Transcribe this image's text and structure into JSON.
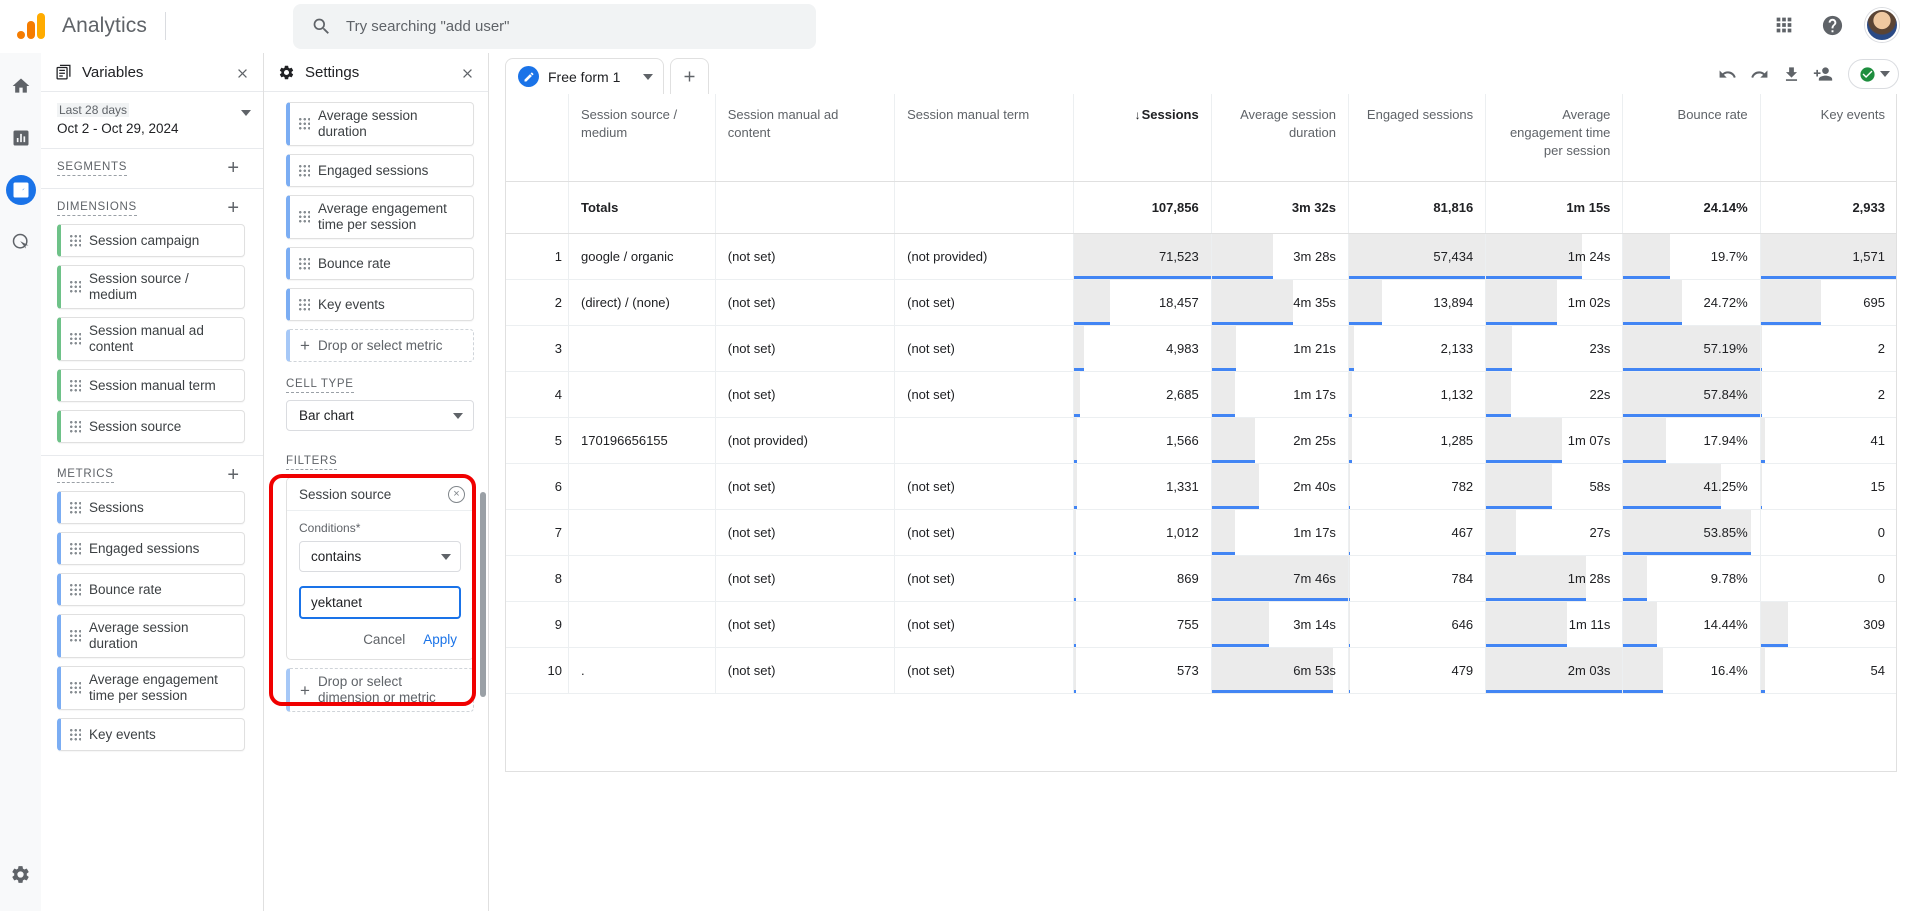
{
  "topbar": {
    "brand": "Analytics",
    "search_placeholder": "Try searching \"add user\"",
    "icons": {
      "search": "search-icon",
      "apps": "apps-grid-icon",
      "help": "help-circle-icon",
      "avatar": "user-avatar"
    }
  },
  "rail": {
    "items": [
      {
        "name": "home",
        "label": "Home"
      },
      {
        "name": "reports",
        "label": "Reports"
      },
      {
        "name": "explore",
        "label": "Explore",
        "active": true
      },
      {
        "name": "advertising",
        "label": "Advertising"
      },
      {
        "name": "admin",
        "label": "Admin"
      }
    ]
  },
  "variables": {
    "title": "Variables",
    "close_label": "×",
    "date_range": {
      "label": "Last 28 days",
      "value": "Oct 2 - Oct 29, 2024"
    },
    "segments": {
      "title": "SEGMENTS",
      "add": "+",
      "items": []
    },
    "dimensions": {
      "title": "DIMENSIONS",
      "add": "+",
      "items": [
        "Session campaign",
        "Session source / medium",
        "Session manual ad content",
        "Session manual term",
        "Session source"
      ]
    },
    "metrics": {
      "title": "METRICS",
      "add": "+",
      "items": [
        "Sessions",
        "Engaged sessions",
        "Bounce rate",
        "Average session duration",
        "Average engagement time per session",
        "Key events"
      ]
    }
  },
  "settings": {
    "title": "Settings",
    "close_label": "×",
    "values_metrics": [
      "Average session duration",
      "Engaged sessions",
      "Average engagement time per session",
      "Bounce rate",
      "Key events"
    ],
    "drop_metric": "Drop or select metric",
    "cell_type": {
      "title": "CELL TYPE",
      "value": "Bar chart"
    },
    "filters": {
      "title": "FILTERS",
      "dimension": "Session source",
      "clear_icon": "clear-circle-icon",
      "conditions_label": "Conditions*",
      "match_type": "contains",
      "value": "yektanet",
      "value_placeholder": "",
      "cancel_label": "Cancel",
      "apply_label": "Apply"
    },
    "drop_dimension_or_metric": "Drop or select dimension or metric"
  },
  "report": {
    "tab": {
      "label": "Free form 1",
      "icon": "pencil-icon"
    },
    "add_tab": "+",
    "tools": [
      {
        "name": "undo-icon",
        "label": "Undo"
      },
      {
        "name": "redo-icon",
        "label": "Redo"
      },
      {
        "name": "download-icon",
        "label": "Download"
      },
      {
        "name": "share-user-icon",
        "label": "Share"
      },
      {
        "name": "check-circle-icon",
        "label": "Saved"
      },
      {
        "name": "chevron-down-icon",
        "label": "More"
      }
    ]
  },
  "table": {
    "columns": [
      {
        "key": "idx",
        "label": "",
        "align": "right"
      },
      {
        "key": "source_medium",
        "label": "Session source / medium",
        "align": "left"
      },
      {
        "key": "ad_content",
        "label": "Session manual ad content",
        "align": "left"
      },
      {
        "key": "manual_term",
        "label": "Session manual term",
        "align": "left"
      },
      {
        "key": "sessions",
        "label": "Sessions",
        "align": "right",
        "sorted": true,
        "sort_arrow": "↓"
      },
      {
        "key": "avg_session_duration",
        "label": "Average session duration",
        "align": "right"
      },
      {
        "key": "engaged_sessions",
        "label": "Engaged sessions",
        "align": "right"
      },
      {
        "key": "avg_engagement_time",
        "label": "Average engagement time per session",
        "align": "right"
      },
      {
        "key": "bounce_rate",
        "label": "Bounce rate",
        "align": "right"
      },
      {
        "key": "key_events",
        "label": "Key events",
        "align": "right"
      }
    ],
    "totals": {
      "label": "Totals",
      "sessions": "107,856",
      "avg_session_duration": "3m 32s",
      "engaged_sessions": "81,816",
      "avg_engagement_time": "1m 15s",
      "bounce_rate": "24.14%",
      "key_events": "2,933"
    },
    "rows": [
      {
        "idx": "1",
        "source_medium": "google / organic",
        "ad_content": "(not set)",
        "manual_term": "(not provided)",
        "sessions": "71,523",
        "sessions_pct": 100,
        "avg_session_duration": "3m 28s",
        "avg_session_duration_pct": 45,
        "engaged_sessions": "57,434",
        "engaged_sessions_pct": 100,
        "avg_engagement_time": "1m 24s",
        "avg_engagement_time_pct": 70,
        "bounce_rate": "19.7%",
        "bounce_rate_pct": 34,
        "key_events": "1,571",
        "key_events_pct": 100
      },
      {
        "idx": "2",
        "source_medium": "(direct) / (none)",
        "ad_content": "(not set)",
        "manual_term": "(not set)",
        "sessions": "18,457",
        "sessions_pct": 26,
        "avg_session_duration": "4m 35s",
        "avg_session_duration_pct": 60,
        "engaged_sessions": "13,894",
        "engaged_sessions_pct": 24,
        "avg_engagement_time": "1m 02s",
        "avg_engagement_time_pct": 52,
        "bounce_rate": "24.72%",
        "bounce_rate_pct": 43,
        "key_events": "695",
        "key_events_pct": 44
      },
      {
        "idx": "3",
        "source_medium": "",
        "ad_content": "(not set)",
        "manual_term": "(not set)",
        "sessions": "4,983",
        "sessions_pct": 7,
        "avg_session_duration": "1m 21s",
        "avg_session_duration_pct": 18,
        "engaged_sessions": "2,133",
        "engaged_sessions_pct": 4,
        "avg_engagement_time": "23s",
        "avg_engagement_time_pct": 19,
        "bounce_rate": "57.19%",
        "bounce_rate_pct": 100,
        "key_events": "2",
        "key_events_pct": 1
      },
      {
        "idx": "4",
        "source_medium": "",
        "ad_content": "(not set)",
        "manual_term": "(not set)",
        "sessions": "2,685",
        "sessions_pct": 4,
        "avg_session_duration": "1m 17s",
        "avg_session_duration_pct": 17,
        "engaged_sessions": "1,132",
        "engaged_sessions_pct": 2,
        "avg_engagement_time": "22s",
        "avg_engagement_time_pct": 18,
        "bounce_rate": "57.84%",
        "bounce_rate_pct": 100,
        "key_events": "2",
        "key_events_pct": 1
      },
      {
        "idx": "5",
        "source_medium": "170196656155",
        "ad_content": "(not provided)",
        "manual_term": "",
        "sessions": "1,566",
        "sessions_pct": 2,
        "avg_session_duration": "2m 25s",
        "avg_session_duration_pct": 32,
        "engaged_sessions": "1,285",
        "engaged_sessions_pct": 2,
        "avg_engagement_time": "1m 07s",
        "avg_engagement_time_pct": 56,
        "bounce_rate": "17.94%",
        "bounce_rate_pct": 31,
        "key_events": "41",
        "key_events_pct": 3
      },
      {
        "idx": "6",
        "source_medium": "",
        "ad_content": "(not set)",
        "manual_term": "(not set)",
        "sessions": "1,331",
        "sessions_pct": 2,
        "avg_session_duration": "2m 40s",
        "avg_session_duration_pct": 35,
        "engaged_sessions": "782",
        "engaged_sessions_pct": 1,
        "avg_engagement_time": "58s",
        "avg_engagement_time_pct": 48,
        "bounce_rate": "41.25%",
        "bounce_rate_pct": 72,
        "key_events": "15",
        "key_events_pct": 1
      },
      {
        "idx": "7",
        "source_medium": "",
        "ad_content": "(not set)",
        "manual_term": "(not set)",
        "sessions": "1,012",
        "sessions_pct": 1,
        "avg_session_duration": "1m 17s",
        "avg_session_duration_pct": 17,
        "engaged_sessions": "467",
        "engaged_sessions_pct": 1,
        "avg_engagement_time": "27s",
        "avg_engagement_time_pct": 22,
        "bounce_rate": "53.85%",
        "bounce_rate_pct": 94,
        "key_events": "0",
        "key_events_pct": 0
      },
      {
        "idx": "8",
        "source_medium": "",
        "ad_content": "(not set)",
        "manual_term": "(not set)",
        "sessions": "869",
        "sessions_pct": 1,
        "avg_session_duration": "7m 46s",
        "avg_session_duration_pct": 100,
        "engaged_sessions": "784",
        "engaged_sessions_pct": 1,
        "avg_engagement_time": "1m 28s",
        "avg_engagement_time_pct": 73,
        "bounce_rate": "9.78%",
        "bounce_rate_pct": 17,
        "key_events": "0",
        "key_events_pct": 0
      },
      {
        "idx": "9",
        "source_medium": "",
        "ad_content": "(not set)",
        "manual_term": "(not set)",
        "sessions": "755",
        "sessions_pct": 1,
        "avg_session_duration": "3m 14s",
        "avg_session_duration_pct": 42,
        "engaged_sessions": "646",
        "engaged_sessions_pct": 1,
        "avg_engagement_time": "1m 11s",
        "avg_engagement_time_pct": 59,
        "bounce_rate": "14.44%",
        "bounce_rate_pct": 25,
        "key_events": "309",
        "key_events_pct": 20
      },
      {
        "idx": "10",
        "source_medium": ".",
        "ad_content": "(not set)",
        "manual_term": "(not set)",
        "sessions": "573",
        "sessions_pct": 1,
        "avg_session_duration": "6m 53s",
        "avg_session_duration_pct": 89,
        "engaged_sessions": "479",
        "engaged_sessions_pct": 1,
        "avg_engagement_time": "2m 03s",
        "avg_engagement_time_pct": 100,
        "bounce_rate": "16.4%",
        "bounce_rate_pct": 29,
        "key_events": "54",
        "key_events_pct": 3
      }
    ]
  },
  "colors": {
    "accent_blue": "#1a73e8",
    "bar_underline": "#4285f4",
    "bar_fill": "#ebebeb",
    "dimension_green": "#6ec288",
    "metric_blue": "#7badf3",
    "highlight_red": "#f00000",
    "brand_orange": "#F57C00",
    "brand_amber": "#FFAB00"
  }
}
